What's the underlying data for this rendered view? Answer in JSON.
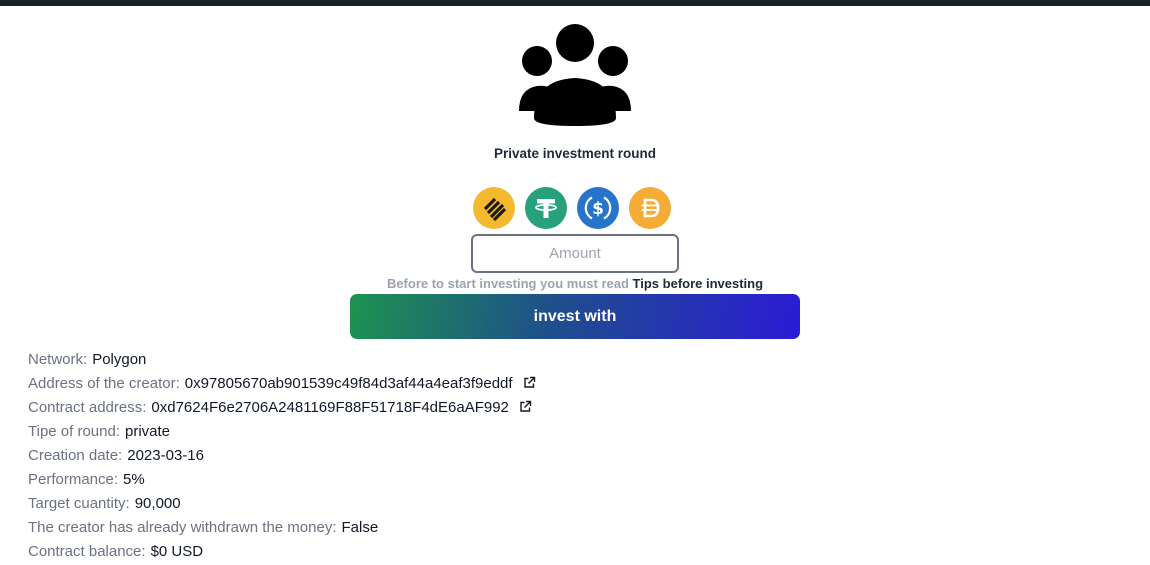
{
  "header": {
    "icon": "users-group-icon",
    "title": "Private investment round"
  },
  "coins": [
    {
      "name": "binance-coin-icon",
      "color": "#F3BA2F"
    },
    {
      "name": "tether-icon",
      "color": "#26A17B"
    },
    {
      "name": "usdc-icon",
      "color": "#2775CA"
    },
    {
      "name": "dai-icon",
      "color": "#F5AC37"
    }
  ],
  "amount": {
    "placeholder": "Amount",
    "value": ""
  },
  "tips": {
    "prefix": "Before to start investing you must read ",
    "link": "Tips before investing"
  },
  "invest_button": {
    "label": "invest with"
  },
  "details": [
    {
      "label": "Network:",
      "value": "Polygon",
      "link": false
    },
    {
      "label": "Address of the creator:",
      "value": "0x97805670ab901539c49f84d3af44a4eaf3f9eddf",
      "link": true
    },
    {
      "label": "Contract address:",
      "value": "0xd7624F6e2706A2481169F88F51718F4dE6aAF992",
      "link": true
    },
    {
      "label": "Tipe of round:",
      "value": "private",
      "link": false
    },
    {
      "label": "Creation date:",
      "value": "2023-03-16",
      "link": false
    },
    {
      "label": "Performance:",
      "value": "5%",
      "link": false
    },
    {
      "label": "Target cuantity:",
      "value": "90,000",
      "link": false
    },
    {
      "label": "The creator has already withdrawn the money:",
      "value": "False",
      "link": false
    },
    {
      "label": "Contract balance:",
      "value": "$0 USD",
      "link": false
    }
  ]
}
